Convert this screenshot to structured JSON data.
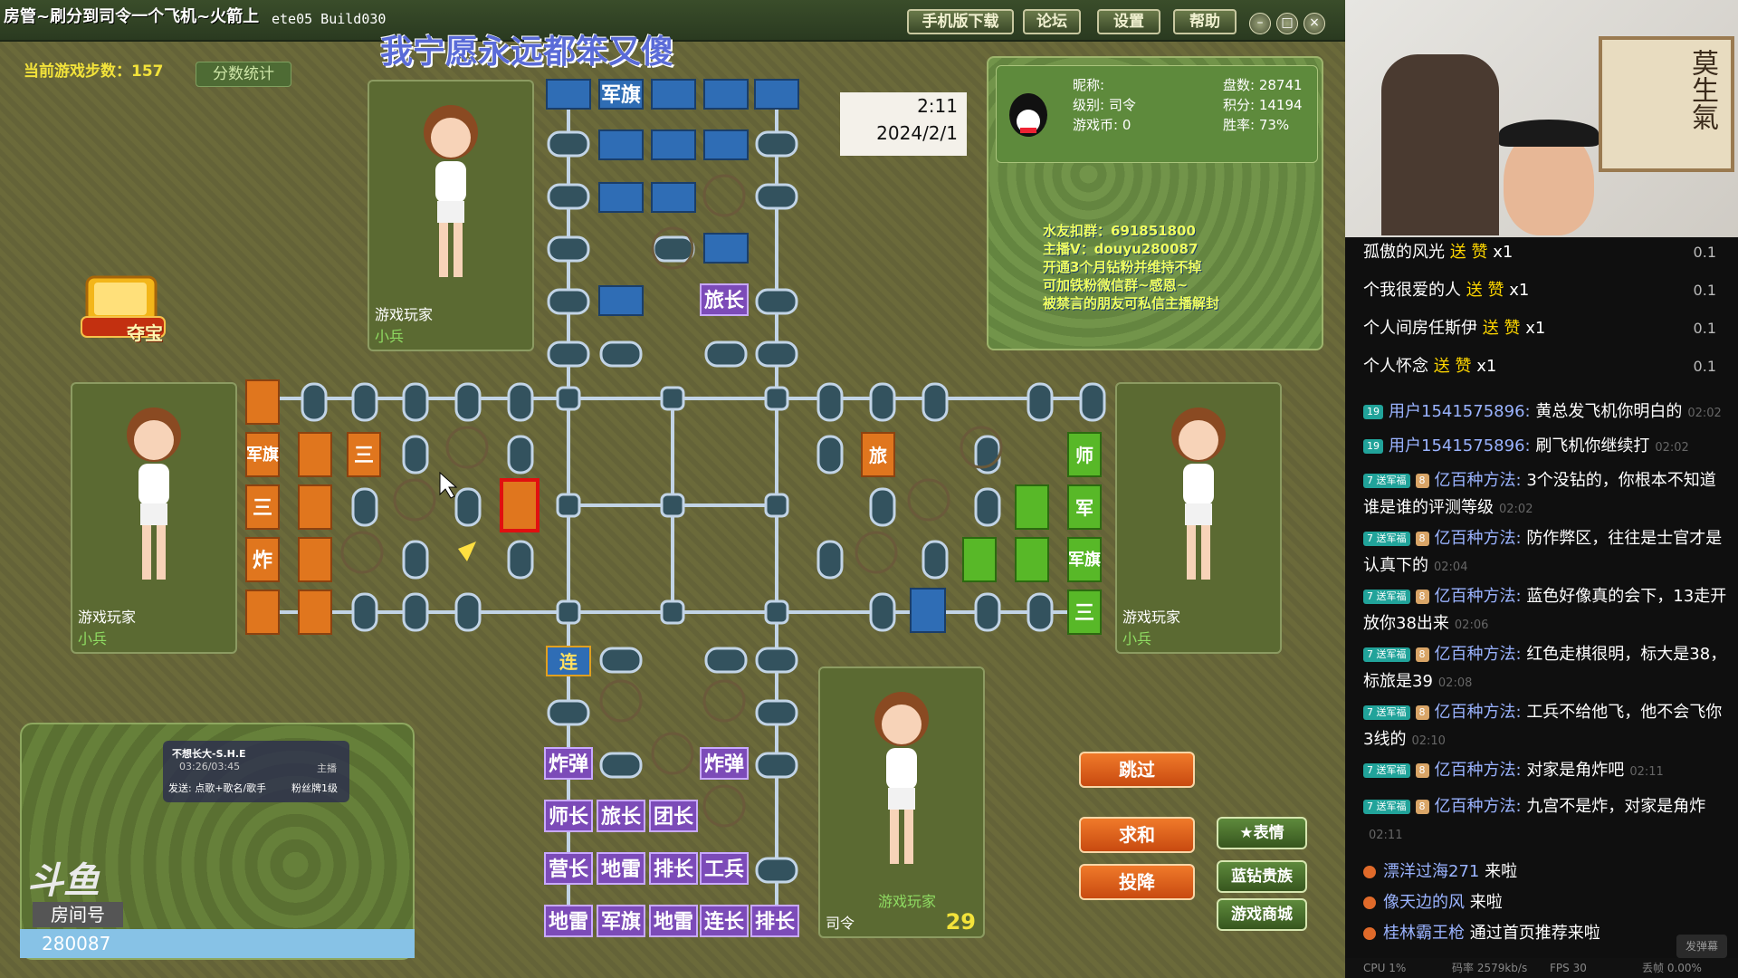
{
  "window": {
    "title": "房管~刷分到司令一个飞机~火箭上",
    "build": "ete05 Build030",
    "buttons": [
      "手机版下载",
      "论坛",
      "设置",
      "帮助"
    ]
  },
  "overlay_title": "我宁愿永远都笨又傻",
  "steps_label": "当前游戏步数：157",
  "score_button": "分数统计",
  "treasure_label": "夺宝",
  "players": {
    "top": {
      "name": "游戏玩家",
      "rank": "小兵"
    },
    "left": {
      "name": "游戏玩家",
      "rank": "小兵"
    },
    "right": {
      "name": "游戏玩家",
      "rank": "小兵"
    },
    "self": {
      "name": "游戏玩家",
      "rank": "司令",
      "timer": "29"
    }
  },
  "info": {
    "nickname_label": "昵称:",
    "level": "级别: 司令",
    "coins": "游戏币: 0",
    "games": "盘数: 28741",
    "points": "积分: 14194",
    "winrate": "胜率: 73%",
    "promo": [
      "水友扣群：691851800",
      "主播V：douyu280087",
      "开通3个月钻粉并维持不掉",
      "可加铁粉微信群~感恩~",
      "被禁言的朋友可私信主播解封"
    ]
  },
  "clock": {
    "time": "2:11",
    "date": "2024/2/1"
  },
  "board": {
    "top_pieces": [
      "军旗",
      "旅长"
    ],
    "left_pieces": [
      "军旗",
      "三",
      "三",
      "炸"
    ],
    "right_pieces": [
      "旅",
      "师",
      "军",
      "军旗",
      "三"
    ],
    "bottom_pieces": [
      "连",
      "炸弹",
      "炸弹",
      "师长",
      "旅长",
      "团长",
      "营长",
      "地雷",
      "排长",
      "工兵",
      "地雷",
      "军旗",
      "地雷",
      "连长",
      "排长"
    ]
  },
  "actions": {
    "skip": "跳过",
    "peace": "求和",
    "surrender": "投降"
  },
  "side_buttons": {
    "emote": "表情",
    "noble": "蓝钻贵族",
    "shop": "游戏商城"
  },
  "music": {
    "song": "不想长大-S.H.E",
    "time": "03:26/03:45",
    "host": "主播",
    "send": "发送: 点歌+歌名/歌手",
    "fan_level": "粉丝牌1级"
  },
  "douyu": {
    "logo": "斗鱼",
    "room_label": "房间号",
    "room_number": "280087"
  },
  "stream_overlay": "莫生氣",
  "chat": {
    "gifts": [
      {
        "user": "孤傲的风光",
        "action": "送 赞",
        "count": "x1",
        "heat": "0.1"
      },
      {
        "user": "个我很爱的人",
        "action": "送 赞",
        "count": "x1",
        "heat": "0.1"
      },
      {
        "user": "个人间房任斯伊",
        "action": "送 赞",
        "count": "x1",
        "heat": "0.1"
      },
      {
        "user": "个人怀念",
        "action": "送 赞",
        "count": "x1",
        "heat": "0.1"
      }
    ],
    "messages": [
      {
        "lvl": "19",
        "fan": "",
        "user": "用户1541575896:",
        "text": "黄总发飞机你明白的",
        "ts": "02:02"
      },
      {
        "lvl": "19",
        "fan": "",
        "user": "用户1541575896:",
        "text": "刷飞机你继续打",
        "ts": "02:02"
      },
      {
        "lvl": "7 送军福",
        "fan": "8",
        "user": "亿百种方法:",
        "text": "3个没钻的，你根本不知道谁是谁的评测等级",
        "ts": "02:02"
      },
      {
        "lvl": "7 送军福",
        "fan": "8",
        "user": "亿百种方法:",
        "text": "防作弊区，往往是士官才是认真下的",
        "ts": "02:04"
      },
      {
        "lvl": "7 送军福",
        "fan": "8",
        "user": "亿百种方法:",
        "text": "蓝色好像真的会下，13走开放你38出来",
        "ts": "02:06"
      },
      {
        "lvl": "7 送军福",
        "fan": "8",
        "user": "亿百种方法:",
        "text": "红色走棋很明，标大是38，标旅是39",
        "ts": "02:08"
      },
      {
        "lvl": "7 送军福",
        "fan": "8",
        "user": "亿百种方法:",
        "text": "工兵不给他飞，他不会飞你3线的",
        "ts": "02:10"
      },
      {
        "lvl": "7 送军福",
        "fan": "8",
        "user": "亿百种方法:",
        "text": "对家是角炸吧",
        "ts": "02:11"
      },
      {
        "lvl": "7 送军福",
        "fan": "8",
        "user": "亿百种方法:",
        "text": "九宫不是炸，对家是角炸",
        "ts": "02:11"
      }
    ],
    "arrivals": [
      {
        "user": "漂洋过海271",
        "text": "来啦"
      },
      {
        "user": "像天边的风",
        "text": "来啦"
      },
      {
        "user": "桂林霸王枪",
        "text": "通过首页推荐来啦"
      }
    ],
    "send_button": "发弹幕"
  },
  "status": {
    "cpu": "CPU 1%",
    "rate": "码率 2579kb/s",
    "fps": "FPS 30",
    "drop": "丢帧 0.00%"
  }
}
